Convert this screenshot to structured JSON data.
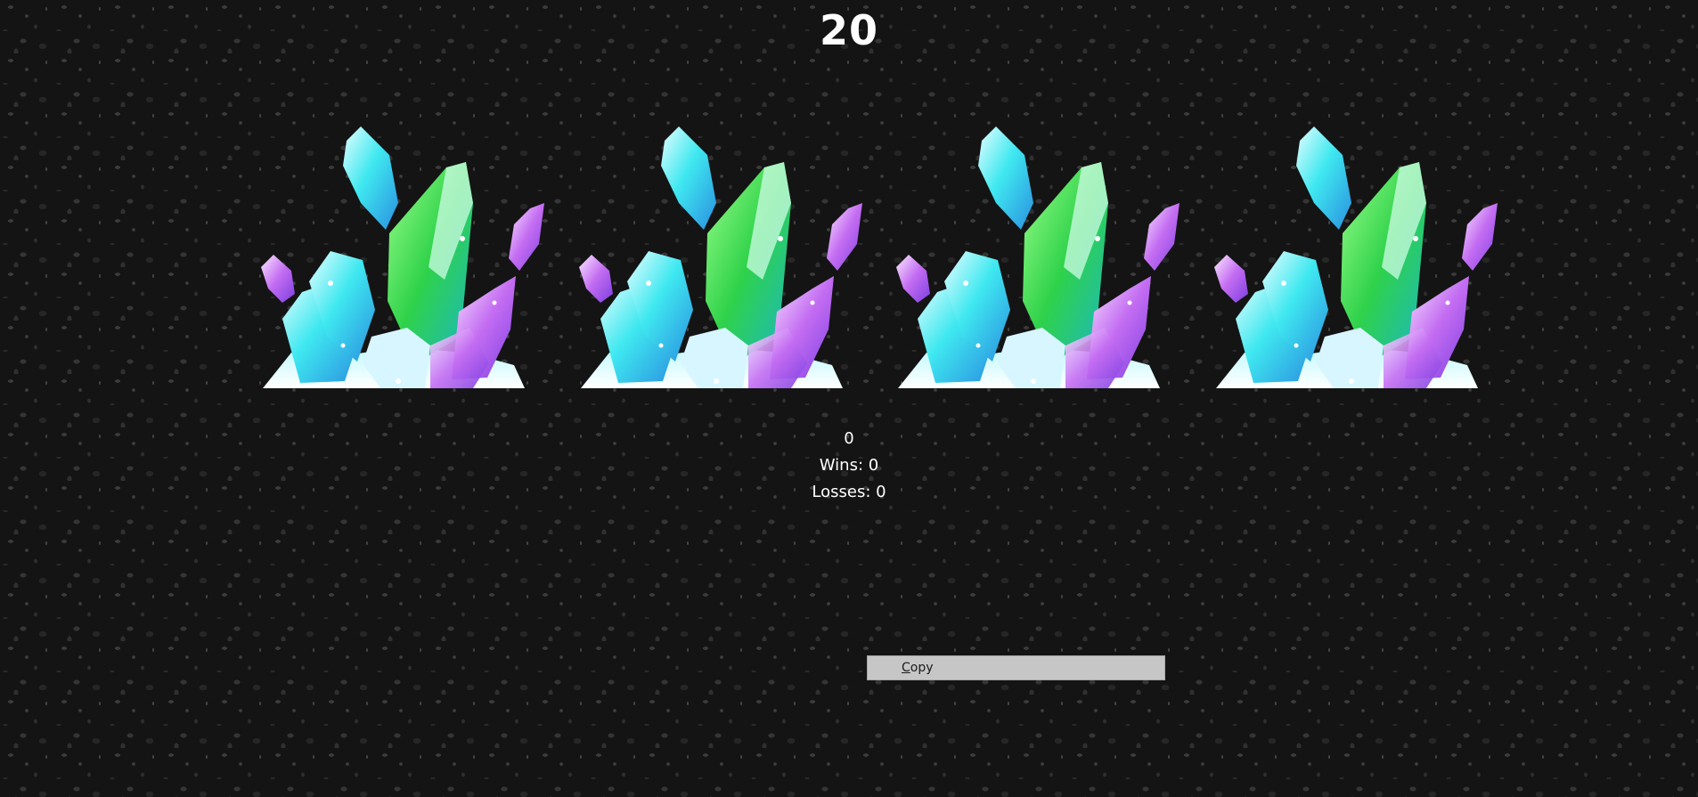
{
  "game": {
    "score": "20",
    "reels": [
      {
        "symbol": "crystal-cluster-icon"
      },
      {
        "symbol": "crystal-cluster-icon"
      },
      {
        "symbol": "crystal-cluster-icon"
      },
      {
        "symbol": "crystal-cluster-icon"
      }
    ],
    "stats": {
      "counter": "0",
      "wins": "Wins: 0",
      "losses": "Losses: 0"
    },
    "copy_button": {
      "accesskey": "C",
      "rest": "opy"
    },
    "colors": {
      "background": "#141414",
      "text": "#ffffff",
      "button": "#c6c6c6",
      "crystal_green": "#2fd24a",
      "crystal_cyan": "#3fe8f0",
      "crystal_purple": "#c36cf2"
    }
  }
}
